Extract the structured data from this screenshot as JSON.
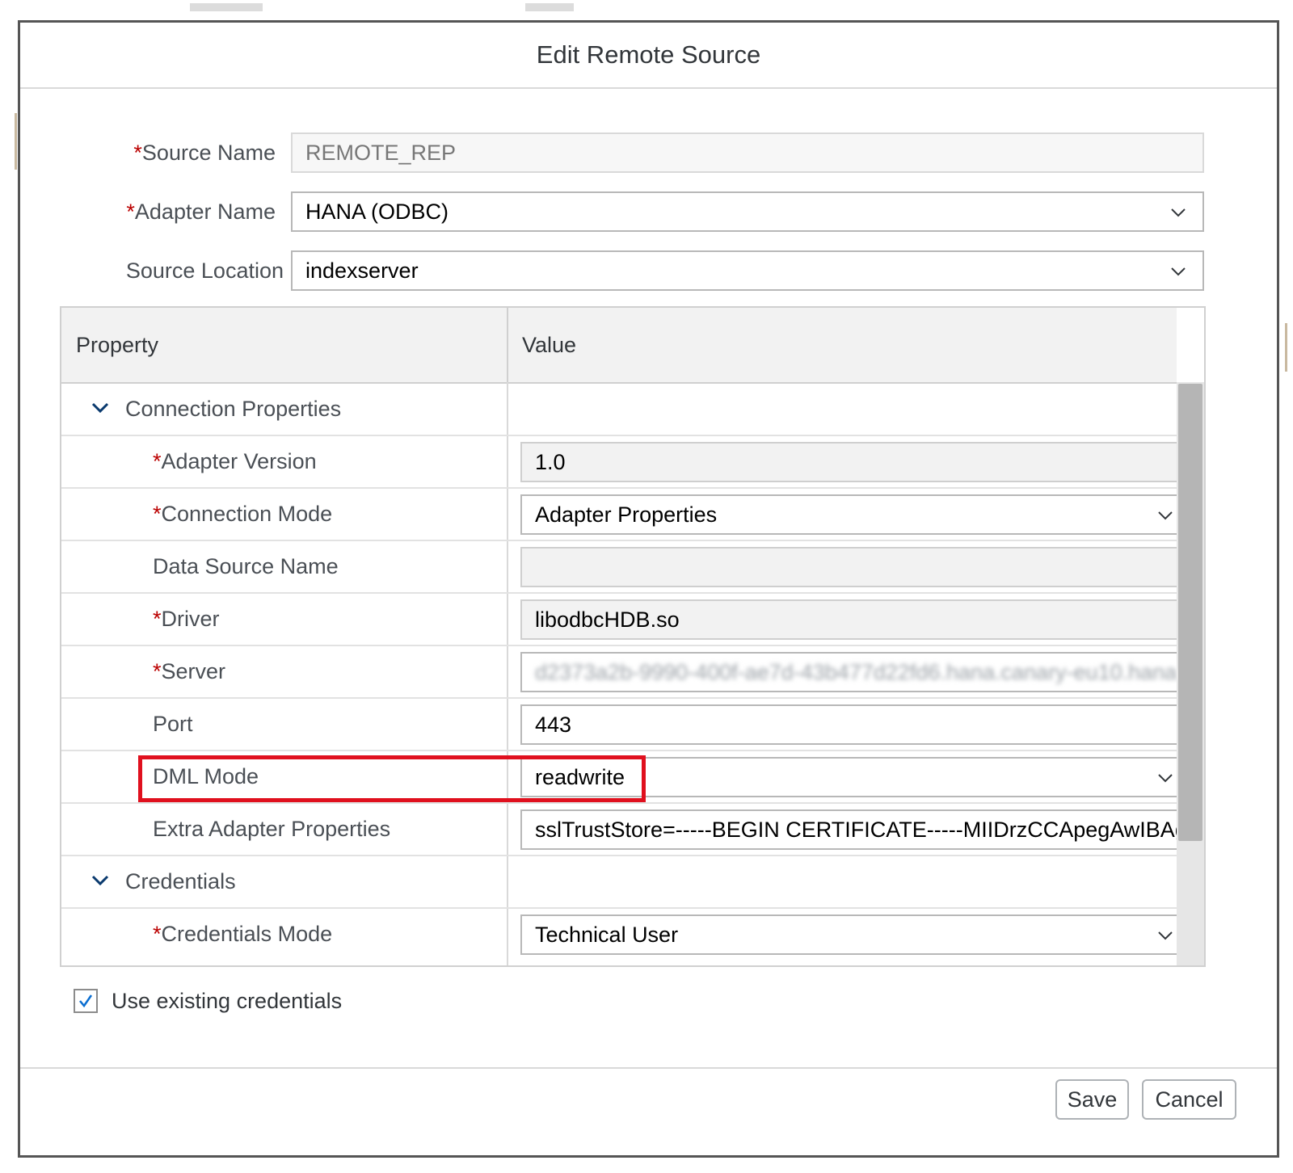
{
  "dialog": {
    "title": "Edit Remote Source"
  },
  "form": {
    "source_name": {
      "label": "Source Name",
      "required_mark": "*",
      "value": "REMOTE_REP"
    },
    "adapter_name": {
      "label": "Adapter Name",
      "required_mark": "*",
      "value": "HANA (ODBC)"
    },
    "source_location": {
      "label": "Source Location",
      "value": "indexserver"
    }
  },
  "table": {
    "columns": [
      "Property",
      "Value"
    ],
    "groups": {
      "connection": "Connection Properties",
      "credentials": "Credentials"
    },
    "rows": [
      {
        "label": "Adapter Version",
        "required": "*",
        "value": "1.0"
      },
      {
        "label": "Connection Mode",
        "required": "*",
        "value": "Adapter Properties"
      },
      {
        "label": "Data Source Name",
        "value": ""
      },
      {
        "label": "Driver",
        "required": "*",
        "value": "libodbcHDB.so"
      },
      {
        "label": "Server",
        "required": "*",
        "value": "d2373a2b-9990-400f-ae7d-43b477d22fd6.hana.canary-eu10.hana"
      },
      {
        "label": "Port",
        "value": "443"
      },
      {
        "label": "DML Mode",
        "value": "readwrite"
      },
      {
        "label": "Extra Adapter Properties",
        "value": "sslTrustStore=-----BEGIN CERTIFICATE-----MIIDrzCCApegAwIBAg"
      },
      {
        "label": "Credentials Mode",
        "required": "*",
        "value": "Technical User"
      }
    ]
  },
  "checkbox": {
    "label": "Use existing credentials",
    "checked": true
  },
  "buttons": {
    "save": "Save",
    "cancel": "Cancel"
  },
  "colors": {
    "required": "#bb0000",
    "highlight": "#e0101e"
  }
}
